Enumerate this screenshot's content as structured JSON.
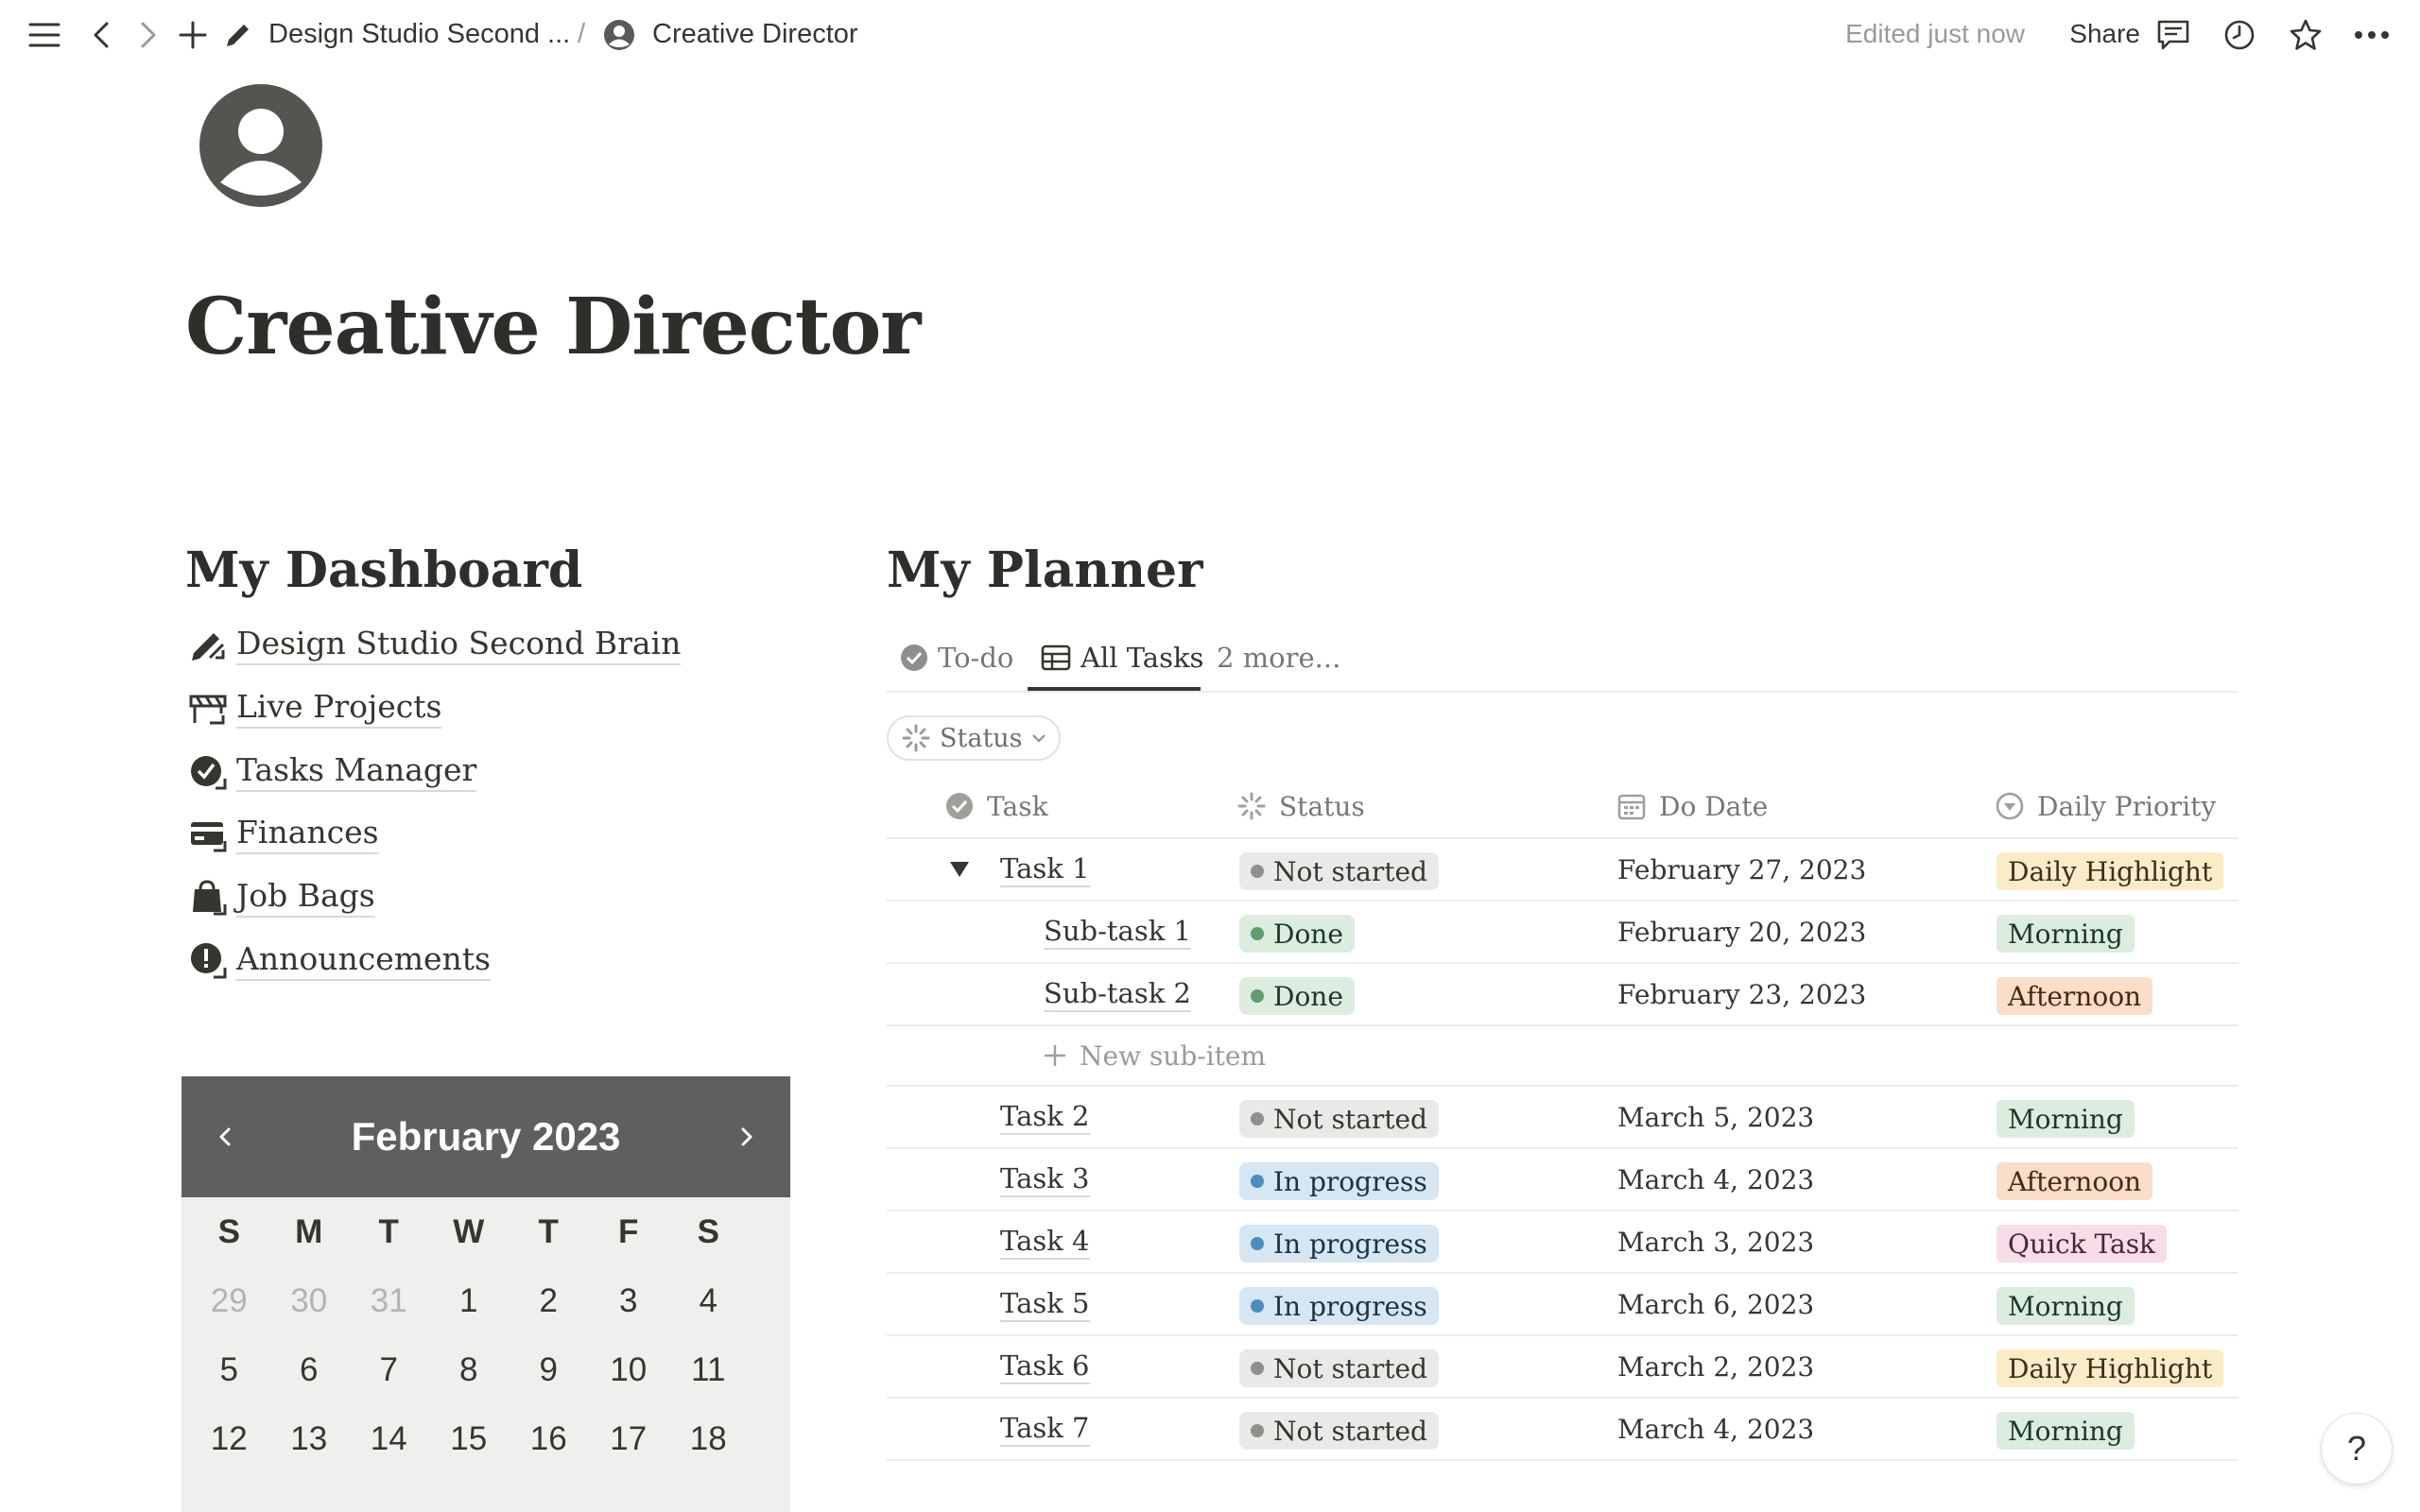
{
  "topbar": {
    "breadcrumb_parent": "Design Studio Second ...",
    "breadcrumb_sep": "/",
    "breadcrumb_current": "Creative Director",
    "edited": "Edited just now",
    "share": "Share"
  },
  "page": {
    "title": "Creative Director"
  },
  "dashboard": {
    "heading": "My Dashboard",
    "links": [
      {
        "label": "Design Studio Second Brain",
        "icon": "pencil-link-icon"
      },
      {
        "label": "Live Projects",
        "icon": "barrier-link-icon"
      },
      {
        "label": "Tasks Manager",
        "icon": "check-circle-link-icon"
      },
      {
        "label": "Finances",
        "icon": "card-link-icon"
      },
      {
        "label": "Job Bags",
        "icon": "bag-link-icon"
      },
      {
        "label": "Announcements",
        "icon": "alert-link-icon"
      }
    ]
  },
  "calendar": {
    "month": "February 2023",
    "weekdays": [
      "S",
      "M",
      "T",
      "W",
      "T",
      "F",
      "S"
    ],
    "weeks": [
      [
        "29",
        "30",
        "31",
        "1",
        "2",
        "3",
        "4"
      ],
      [
        "5",
        "6",
        "7",
        "8",
        "9",
        "10",
        "11"
      ],
      [
        "12",
        "13",
        "14",
        "15",
        "16",
        "17",
        "18"
      ]
    ]
  },
  "planner": {
    "heading": "My Planner",
    "tabs": {
      "todo": "To-do",
      "all": "All Tasks",
      "more": "2 more..."
    },
    "filter": "Status",
    "columns": {
      "task": "Task",
      "status": "Status",
      "date": "Do Date",
      "priority": "Daily Priority"
    },
    "new_sub_item": "New sub-item",
    "rows": [
      {
        "task": "Task 1",
        "status": "Not started",
        "date": "February 27, 2023",
        "priority": "Daily Highlight"
      },
      {
        "task": "Sub-task 1",
        "status": "Done",
        "date": "February 20, 2023",
        "priority": "Morning"
      },
      {
        "task": "Sub-task 2",
        "status": "Done",
        "date": "February 23, 2023",
        "priority": "Afternoon"
      },
      {
        "task": "Task 2",
        "status": "Not started",
        "date": "March 5, 2023",
        "priority": "Morning"
      },
      {
        "task": "Task 3",
        "status": "In progress",
        "date": "March 4, 2023",
        "priority": "Afternoon"
      },
      {
        "task": "Task 4",
        "status": "In progress",
        "date": "March 3, 2023",
        "priority": "Quick Task"
      },
      {
        "task": "Task 5",
        "status": "In progress",
        "date": "March 6, 2023",
        "priority": "Morning"
      },
      {
        "task": "Task 6",
        "status": "Not started",
        "date": "March 2, 2023",
        "priority": "Daily Highlight"
      },
      {
        "task": "Task 7",
        "status": "Not started",
        "date": "March 4, 2023",
        "priority": "Morning"
      }
    ]
  },
  "colors": {
    "status_not_started_bg": "#e9e9e7",
    "status_not_started_dot": "#8f8f8c",
    "status_done_bg": "#dcecdf",
    "status_done_dot": "#5f9c6f",
    "status_in_progress_bg": "#d6e6f2",
    "status_in_progress_dot": "#4c8dbc",
    "prio_daily_highlight": "#fbecc8",
    "prio_morning": "#dcecdf",
    "prio_afternoon": "#fadec9",
    "prio_quick_task": "#f6dde7"
  },
  "help": "?"
}
